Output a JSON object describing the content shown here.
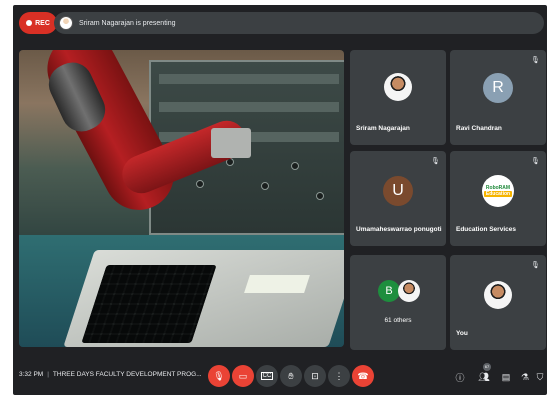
{
  "topbar": {
    "rec_label": "REC",
    "presenting_text": "Sriram Nagarajan is presenting"
  },
  "tiles": [
    {
      "name": "Sriram Nagarajan",
      "avatar_type": "photo",
      "mic": "on"
    },
    {
      "name": "Ravi Chandran",
      "avatar_type": "letter",
      "letter": "R",
      "avatar_color": "#8aa0b3",
      "mic": "off"
    },
    {
      "name": "Umamaheswarrao ponugoti",
      "avatar_type": "letter",
      "letter": "U",
      "avatar_color": "#7a4a2e",
      "mic": "off"
    },
    {
      "name": "Education Services",
      "avatar_type": "logo",
      "logo_line1": "RoboRAM",
      "logo_line2": "Education",
      "mic": "off"
    },
    {
      "name": "61 others",
      "avatar_type": "group",
      "letter": "B",
      "avatar_color": "#1e8e3e"
    },
    {
      "name": "You",
      "avatar_type": "photo",
      "mic": "off"
    }
  ],
  "bottom_bar": {
    "time": "3:32 PM",
    "meeting_title": "THREE DAYS FACULTY DEVELOPMENT PROG...",
    "controls": [
      {
        "name": "mic-toggle-button",
        "icon": "mic-off-icon"
      },
      {
        "name": "camera-toggle-button",
        "icon": "camera-off-icon"
      },
      {
        "name": "captions-button",
        "icon": "cc-icon"
      },
      {
        "name": "raise-hand-button",
        "icon": "hand-icon"
      },
      {
        "name": "present-button",
        "icon": "present-icon"
      },
      {
        "name": "more-options-button",
        "icon": "more-vert-icon"
      },
      {
        "name": "end-call-button",
        "icon": "phone-end-icon"
      }
    ],
    "participants_badge": "67"
  },
  "colors": {
    "background": "#202124",
    "tile": "#3c4043",
    "rec": "#d93025",
    "end_call": "#ea4335"
  }
}
